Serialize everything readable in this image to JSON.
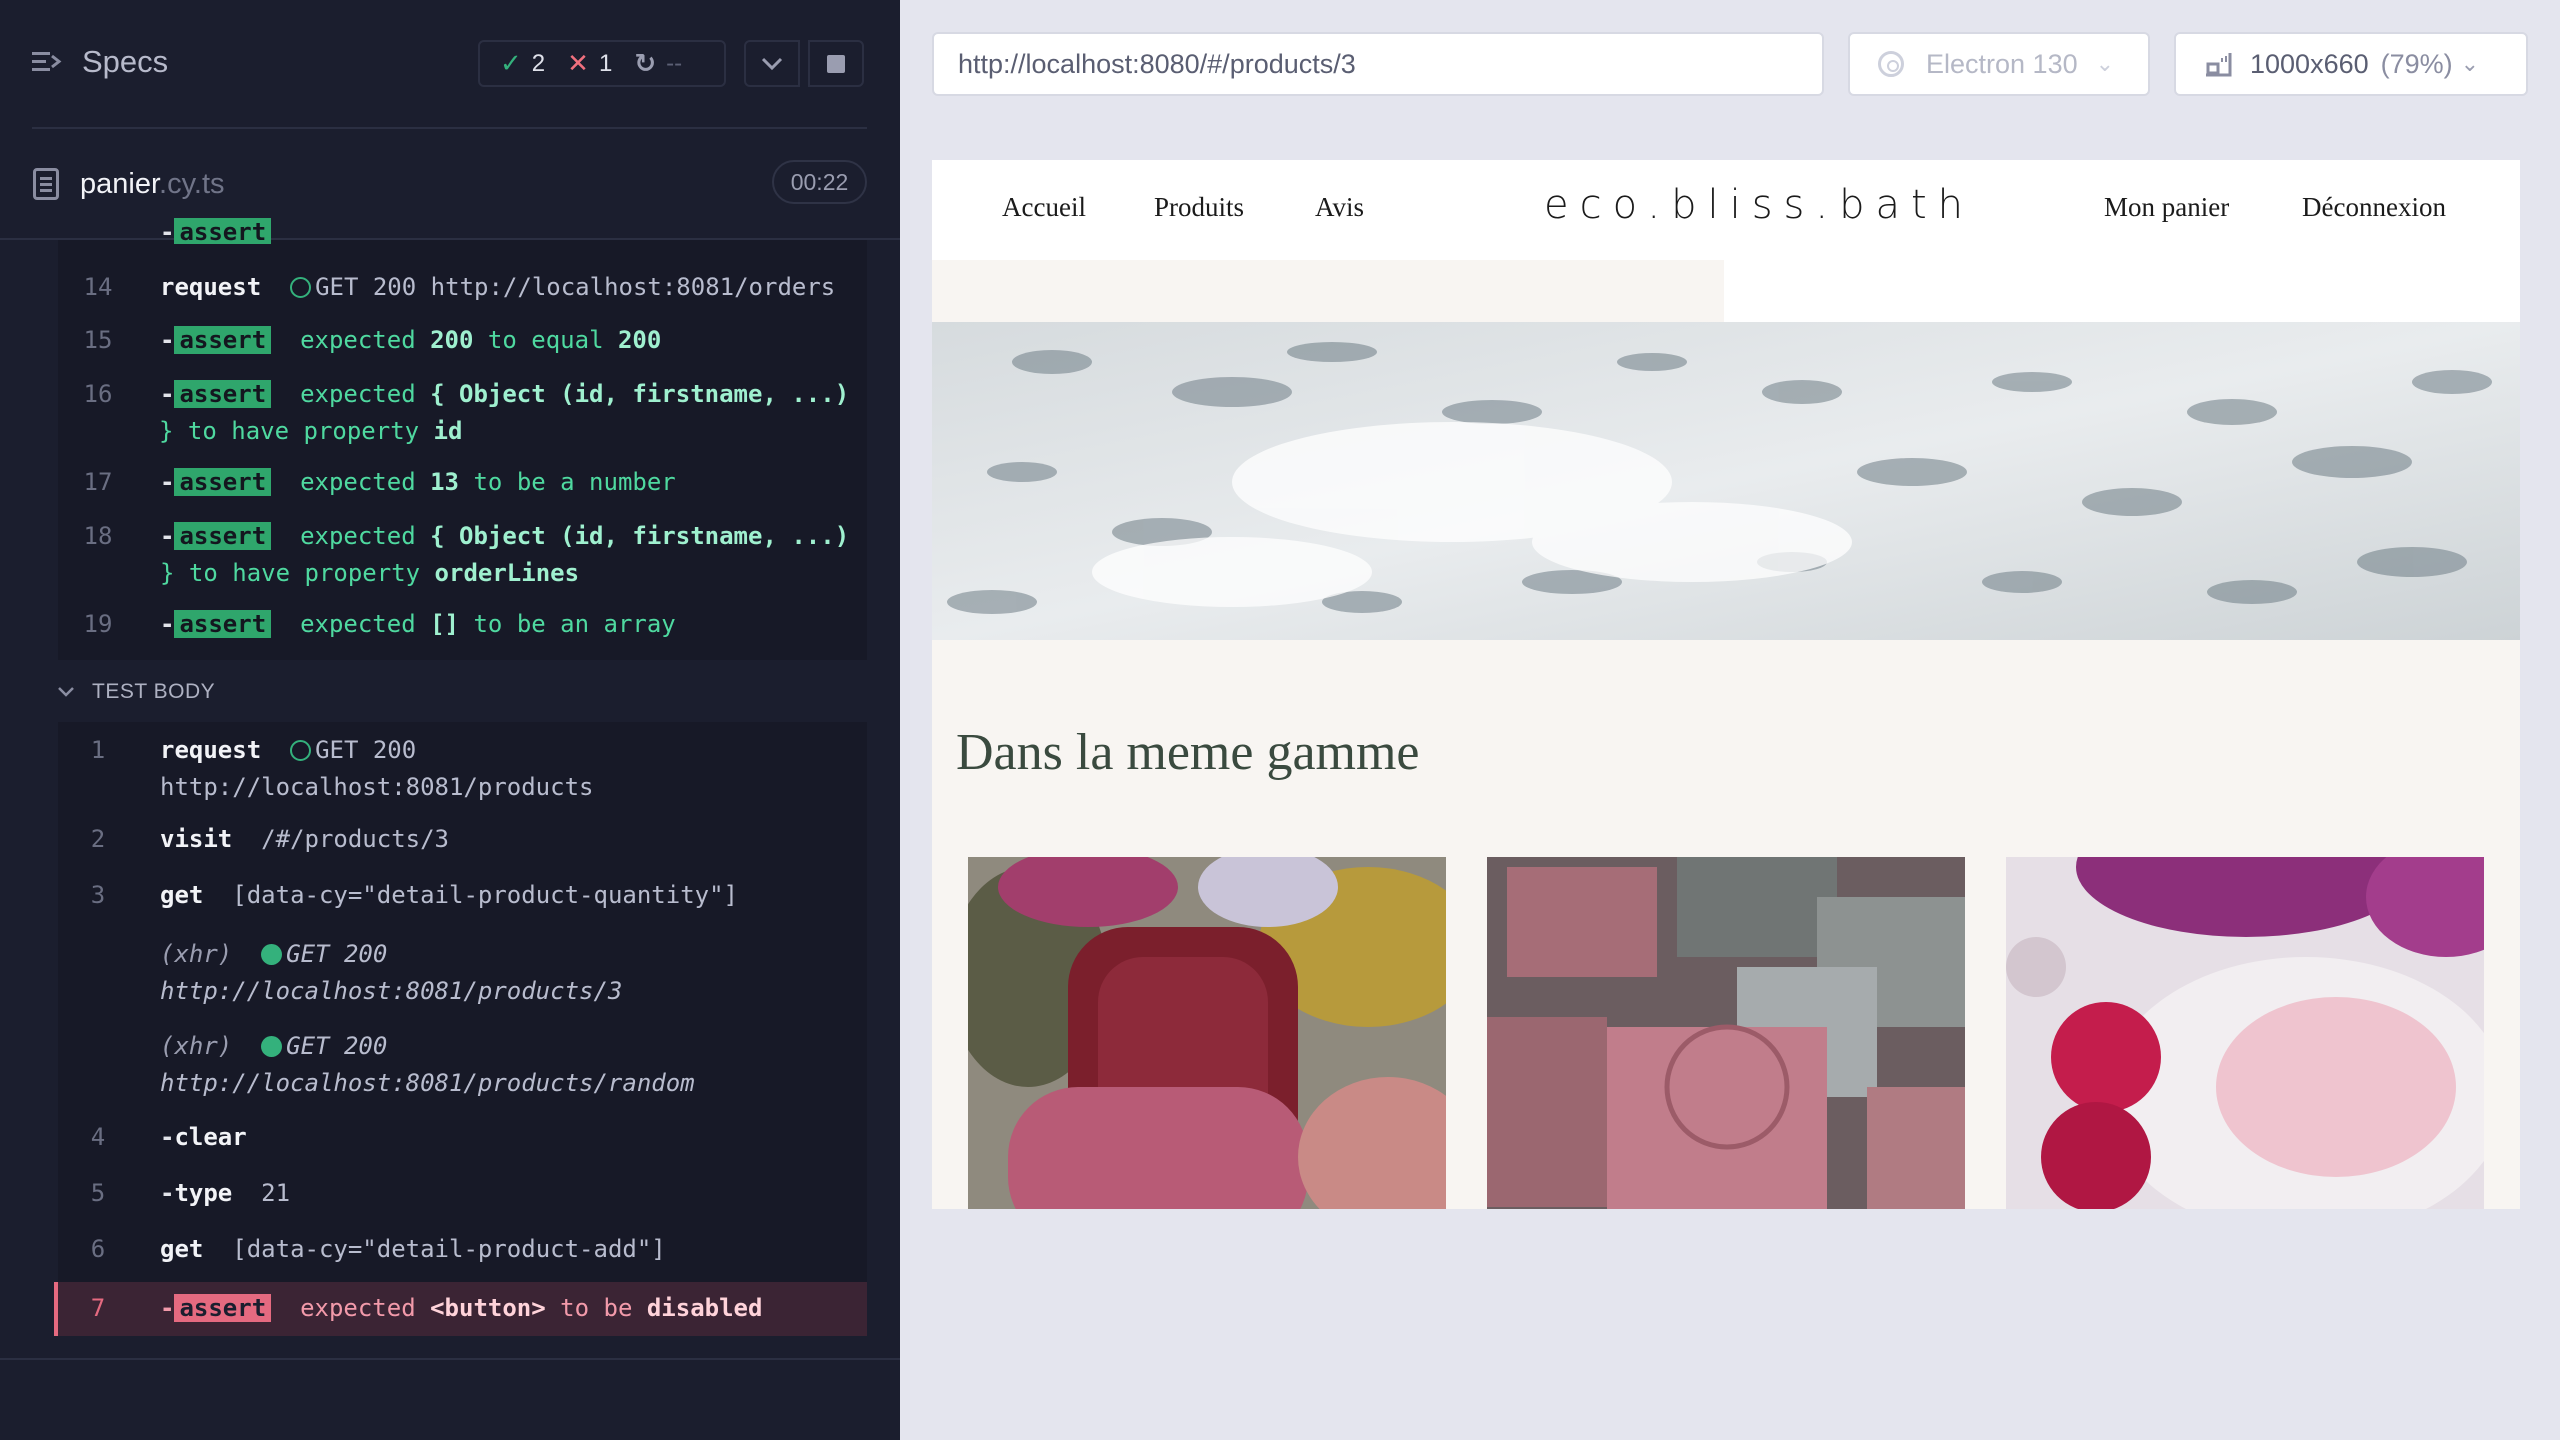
{
  "reporter": {
    "title": "Specs",
    "stats": {
      "passed": "2",
      "failed": "1",
      "pending": "--"
    },
    "file": {
      "name": "panier",
      "ext": ".cy.ts"
    },
    "duration": "00:22",
    "hook_commands": [
      {
        "num": "14",
        "kind": "request",
        "name": "request",
        "method": "GET 200",
        "url": "http://localhost:8081/orders"
      },
      {
        "num": "15",
        "kind": "assert",
        "name": "assert",
        "parts": [
          "expected ",
          "200",
          " to equal ",
          "200"
        ]
      },
      {
        "num": "16",
        "kind": "assert",
        "name": "assert",
        "line1": [
          "expected ",
          "{ Object (id, firstname, ...)"
        ],
        "line2": [
          "} to have property ",
          "id"
        ]
      },
      {
        "num": "17",
        "kind": "assert",
        "name": "assert",
        "parts": [
          "expected ",
          "13",
          " to be a number",
          ""
        ]
      },
      {
        "num": "18",
        "kind": "assert",
        "name": "assert",
        "line1": [
          "expected ",
          "{ Object (id, firstname, ...)"
        ],
        "line2": [
          "} to have property ",
          "orderLines"
        ]
      },
      {
        "num": "19",
        "kind": "assert",
        "name": "assert",
        "parts": [
          "expected ",
          "[]",
          " to be an array",
          ""
        ]
      }
    ],
    "test_body_label": "TEST BODY",
    "body_commands": [
      {
        "num": "1",
        "name": "request",
        "method": "GET 200",
        "url": "http://localhost:8081/products"
      },
      {
        "num": "2",
        "name": "visit",
        "arg": "/#/products/3"
      },
      {
        "num": "3",
        "name": "get",
        "arg": "[data-cy=\"detail-product-quantity\"]"
      },
      {
        "xhr": "(xhr)",
        "method": "GET 200",
        "url": "http://localhost:8081/products/3"
      },
      {
        "xhr": "(xhr)",
        "method": "GET 200",
        "url": "http://localhost:8081/products/random"
      },
      {
        "num": "4",
        "name": "clear",
        "prefix": "-"
      },
      {
        "num": "5",
        "name": "type",
        "prefix": "-",
        "arg": "21"
      },
      {
        "num": "6",
        "name": "get",
        "arg": "[data-cy=\"detail-product-add\"]"
      },
      {
        "num": "7",
        "name": "assert",
        "prefix": "-",
        "parts": [
          "expected ",
          "<button>",
          " to be ",
          "disabled"
        ],
        "state": "failed"
      }
    ]
  },
  "aut": {
    "url": "http://localhost:8080/#/products/3",
    "browser": "Electron 130",
    "viewport": "1000x660",
    "scale": "(79%)"
  },
  "site": {
    "nav": {
      "home": "Accueil",
      "products": "Produits",
      "reviews": "Avis",
      "cart": "Mon panier",
      "logout": "Déconnexion"
    },
    "logo": "eco.bliss.bath",
    "section_title": "Dans la meme gamme"
  },
  "colors": {
    "pass": "#34b17c",
    "fail": "#e56a80",
    "panel": "#1b1e2e"
  }
}
